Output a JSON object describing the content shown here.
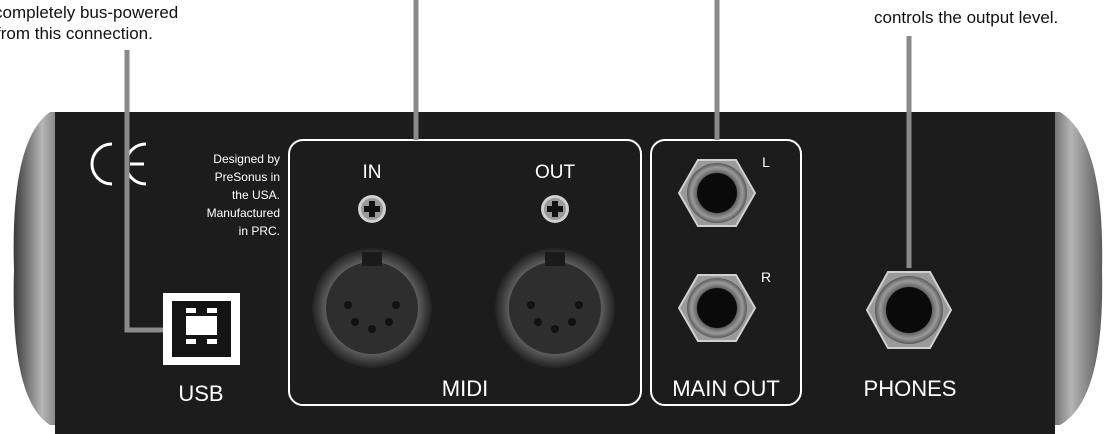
{
  "callouts": {
    "usb_line1": "completely bus-powered",
    "usb_line2": "from this connection.",
    "phones": "controls the output level."
  },
  "panel": {
    "ce_mark": "CE",
    "designed_lines": [
      "Designed by",
      "PreSonus in",
      "the USA.",
      "Manufactured",
      "in PRC."
    ]
  },
  "labels": {
    "usb": "USB",
    "midi_in": "IN",
    "midi_out": "OUT",
    "midi": "MIDI",
    "main_left": "L",
    "main_right": "R",
    "main_out": "MAIN OUT",
    "phones": "PHONES"
  },
  "colors": {
    "panel": "#1c1c1c",
    "outline": "#ffffff",
    "callout_line": "#8a8a8a"
  },
  "icons": [
    "ce-mark-icon",
    "screw-icon",
    "midi-din-connector-icon",
    "usb-b-port-icon",
    "quarter-inch-jack-icon"
  ]
}
